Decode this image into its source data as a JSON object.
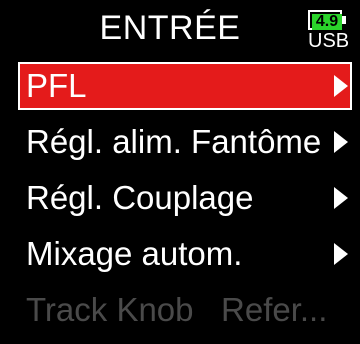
{
  "screen": {
    "title": "ENTRÉE",
    "battery": {
      "voltage": "4.9",
      "source": "USB",
      "fill_color": "#2bd42b"
    },
    "colors": {
      "background": "#000000",
      "selection": "#e41b1b",
      "disabled_text": "#4a4a4a"
    },
    "menu": [
      {
        "label": "PFL",
        "selected": true,
        "has_submenu": true,
        "enabled": true
      },
      {
        "label": "Régl. alim. Fantôme",
        "selected": false,
        "has_submenu": true,
        "enabled": true
      },
      {
        "label": "Régl. Couplage",
        "selected": false,
        "has_submenu": true,
        "enabled": true
      },
      {
        "label": "Mixage autom.",
        "selected": false,
        "has_submenu": true,
        "enabled": true
      },
      {
        "label": "Track Knob   Refer...",
        "selected": false,
        "has_submenu": false,
        "enabled": false
      }
    ]
  }
}
